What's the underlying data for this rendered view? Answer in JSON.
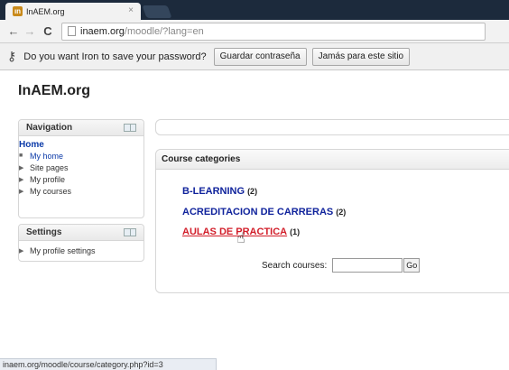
{
  "browser": {
    "tab_favicon": "ın",
    "tab_title": "InAEM.org",
    "tab_close": "×",
    "back_icon": "←",
    "forward_icon": "→",
    "reload_icon": "C",
    "url_host": "inaem.org",
    "url_path": "/moodle/?lang=en"
  },
  "infobar": {
    "text": "Do you want Iron to save your password?",
    "save_button": "Guardar contraseña",
    "never_button": "Jamás para este sitio"
  },
  "site": {
    "title": "InAEM.org"
  },
  "navigation": {
    "title": "Navigation",
    "home": "Home",
    "items": [
      {
        "label": "My home",
        "bullet": "■"
      },
      {
        "label": "Site pages",
        "bullet": "▶"
      },
      {
        "label": "My profile",
        "bullet": "▶"
      },
      {
        "label": "My courses",
        "bullet": "▶"
      }
    ]
  },
  "settings": {
    "title": "Settings",
    "items": [
      {
        "label": "My profile settings",
        "bullet": "▶"
      }
    ]
  },
  "course_categories": {
    "title": "Course categories",
    "items": [
      {
        "name": "B-LEARNING",
        "count": "(2)"
      },
      {
        "name": "ACREDITACION DE CARRERAS",
        "count": "(2)"
      },
      {
        "name": "AULAS DE PRACTICA",
        "count": "(1)"
      }
    ]
  },
  "search": {
    "label": "Search courses:",
    "value": "",
    "go": "Go"
  },
  "status": {
    "url": "inaem.org/moodle/course/category.php?id=3"
  }
}
